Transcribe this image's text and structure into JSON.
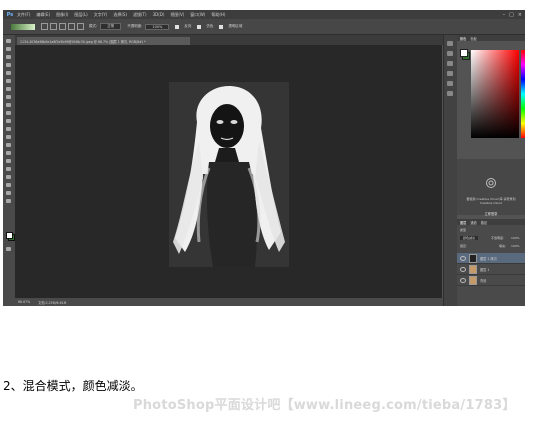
{
  "app": {
    "logo": "Ps"
  },
  "menu": [
    "文件(F)",
    "编辑(E)",
    "图像(I)",
    "图层(L)",
    "文字(Y)",
    "选择(S)",
    "滤镜(T)",
    "3D(D)",
    "视图(V)",
    "窗口(W)",
    "帮助(H)"
  ],
  "window_controls": [
    "–",
    "□",
    "×"
  ],
  "options_bar": {
    "mode_label": "模式:",
    "mode_value": "正常",
    "opacity_label": "不透明度:",
    "opacity_value": "100%",
    "reverse_label": "反向",
    "dither_label": "仿色",
    "transparency_label": "透明区域"
  },
  "document_tab": "1134-4036a98b0e1a8f2e5b99@0f48c30.jpeg @ 66.7% (图层 1 拷贝, RGB/8#) *",
  "status_bar": {
    "zoom": "66.67%",
    "doc_size": "文档:2.25M/6.61M"
  },
  "panels": {
    "color_tabs": [
      "颜色",
      "色板"
    ],
    "cc_text": "要使用 Creative Cloud 库,请登录到 Creative Cloud",
    "cc_link": "立即登录",
    "layer_tabs": [
      "图层",
      "通道",
      "路径"
    ],
    "filter_label": "类型",
    "blend_mode": "颜色减淡",
    "opacity_label": "不透明度:",
    "opacity_value": "100%",
    "lock_label": "锁定:",
    "fill_label": "填充:",
    "fill_value": "100%",
    "layers": [
      {
        "name": "图层 1 拷贝",
        "selected": true
      },
      {
        "name": "图层 1",
        "selected": false
      },
      {
        "name": "背景",
        "selected": false
      }
    ]
  },
  "caption": "2、混合模式，颜色减淡。",
  "watermark": "PhotoShop平面设计吧【www.lineeg.com/tieba/1783】"
}
